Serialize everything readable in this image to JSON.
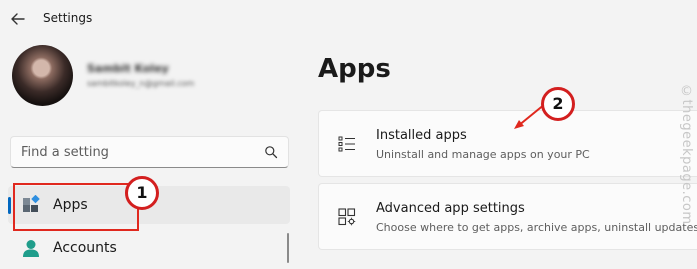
{
  "window": {
    "title": "Settings"
  },
  "user": {
    "name": "Sambit Koley",
    "email": "sambitkoley_n@gmail.com"
  },
  "search": {
    "placeholder": "Find a setting"
  },
  "sidebar": {
    "items": [
      {
        "label": "Apps",
        "selected": true
      },
      {
        "label": "Accounts",
        "selected": false
      }
    ]
  },
  "main": {
    "title": "Apps",
    "cards": [
      {
        "title": "Installed apps",
        "subtitle": "Uninstall and manage apps on your PC",
        "icon": "installed-apps-icon"
      },
      {
        "title": "Advanced app settings",
        "subtitle": "Choose where to get apps, archive apps, uninstall updates",
        "icon": "advanced-app-settings-icon"
      }
    ]
  },
  "annotations": {
    "badge1": "1",
    "badge2": "2"
  },
  "watermark": "©thegeekpage.com",
  "colors": {
    "accent": "#0067c0",
    "annotation_red": "#d31f1f",
    "background": "#f3f3f3"
  }
}
